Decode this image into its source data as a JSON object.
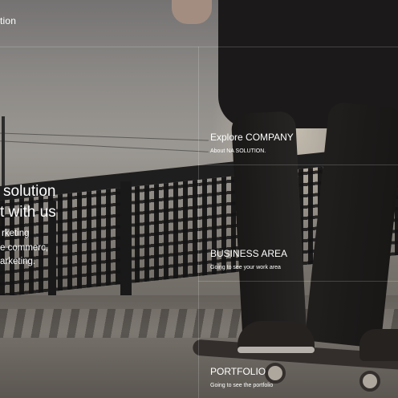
{
  "header": {
    "brand_fragment": "tion"
  },
  "hero": {
    "title_line1": "solution",
    "title_line2": "t with us",
    "desc_line1": "rketing",
    "desc_line2": "e commerc,",
    "desc_line3": "arketing."
  },
  "panels": [
    {
      "title": "Explore COMPANY",
      "subtitle": "About NA SOLUTION."
    },
    {
      "title": "BUSINESS AREA",
      "subtitle": "Going to see your work area"
    },
    {
      "title": "PORTFOLIO",
      "subtitle": "Going to see the portfolio"
    }
  ],
  "colors": {
    "text": "#ffffff",
    "grid_line": "rgba(255,255,255,0.18)"
  }
}
